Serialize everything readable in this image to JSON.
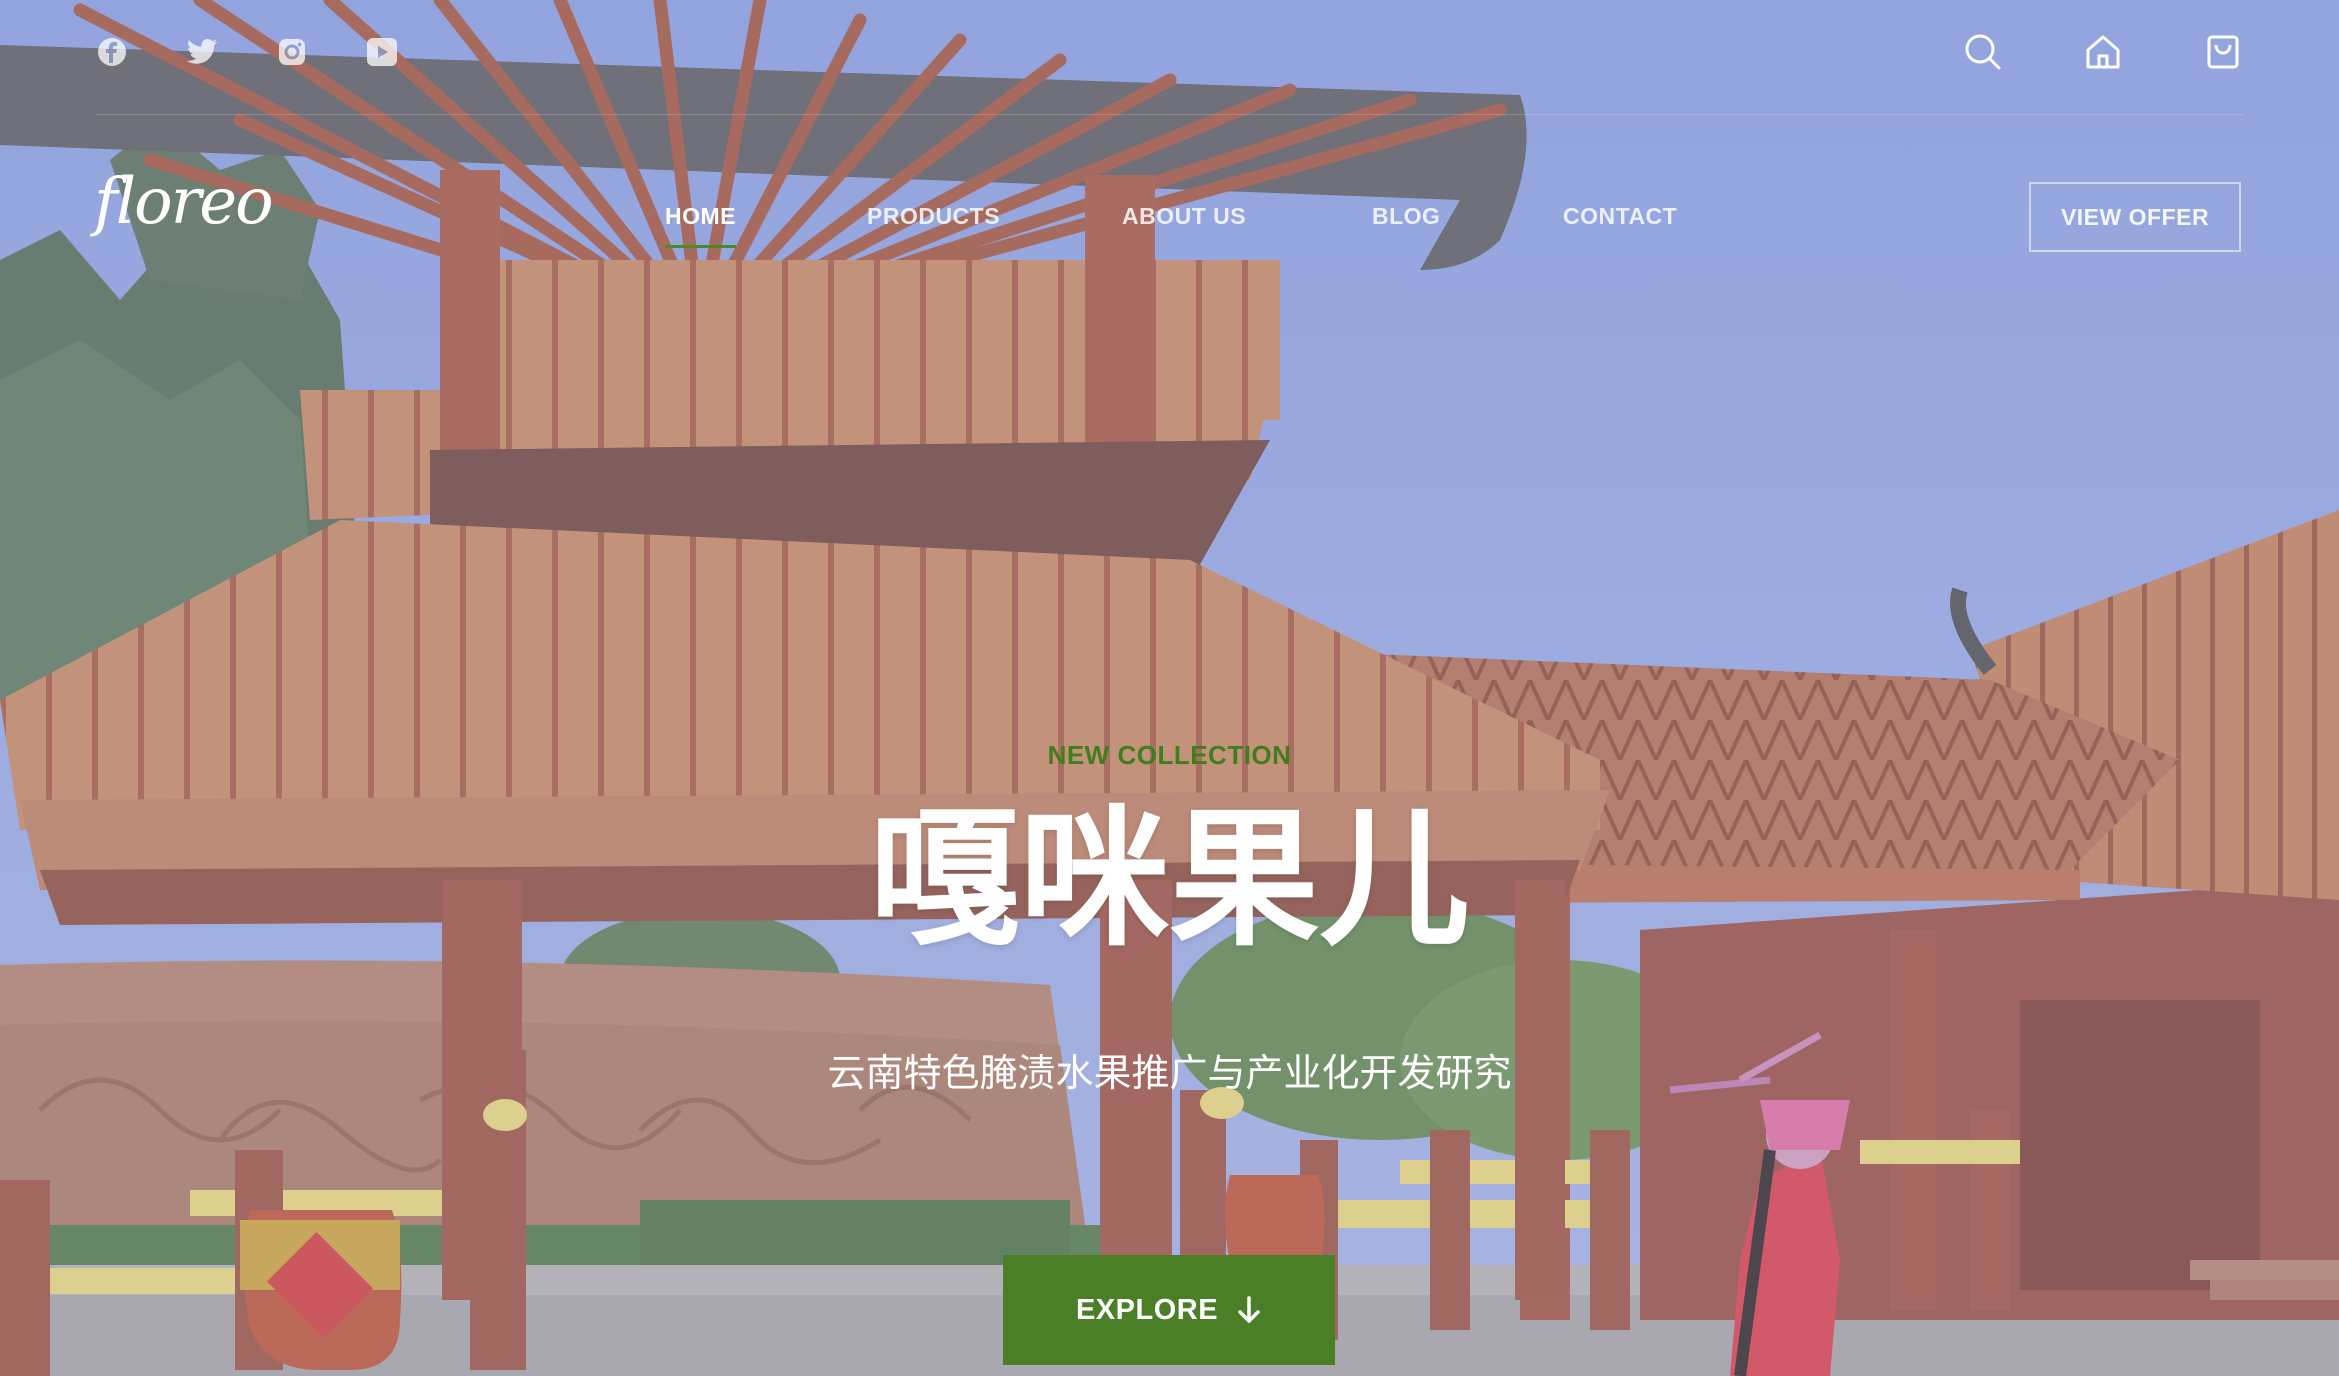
{
  "brand": {
    "logo_text": "floreo"
  },
  "topbar": {
    "socials": [
      "facebook-icon",
      "twitter-icon",
      "instagram-icon",
      "youtube-icon"
    ],
    "utilities": [
      "search-icon",
      "home-icon",
      "shopping-bag-icon"
    ]
  },
  "nav": {
    "items": [
      {
        "label": "HOME",
        "active": true
      },
      {
        "label": "PRODUCTS",
        "active": false
      },
      {
        "label": "ABOUT US",
        "active": false
      },
      {
        "label": "BLOG",
        "active": false
      },
      {
        "label": "CONTACT",
        "active": false
      }
    ],
    "offer_label": "VIEW OFFER"
  },
  "hero": {
    "eyebrow": "NEW COLLECTION",
    "title": "嘎咪果儿",
    "subtitle": "云南特色腌渍水果推广与产业化开发研究",
    "cta_label": "EXPLORE"
  },
  "colors": {
    "accent_green": "#4b7f27",
    "eyebrow_green": "#3f7d1d",
    "sky": "#8fa6ea",
    "roof_orange": "#c87a52",
    "pillar_red": "#9a4f3e"
  }
}
